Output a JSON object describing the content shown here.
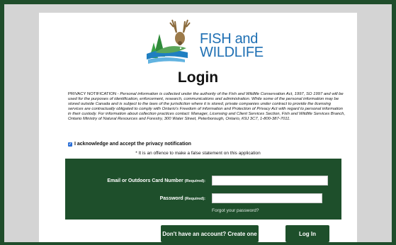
{
  "brand": {
    "line1": "FISH and",
    "line2": "WILDLIFE",
    "color": "#1e6fb3"
  },
  "page_title": "Login",
  "privacy": {
    "lead": "PRIVACY NOTIFICATION - ",
    "body": "Personal information is collected under the authority of the Fish and Wildlife Conservation Act, 1997, SO 1997 and will be used for the purposes of identification, enforcement, research, communications and administration. While some of the personal information may be stored outside Canada and is subject to the laws of the jurisdiction where it is stored, private companies under contract to provide the licensing services are contractually obligated to comply with Ontario's Freedom of information and Protection of Privacy Act with regard to personal information in their custody. For information about collection practices contact: Manager, Licensing and Client Services Section, Fish and Wildlife Services Branch, Ontario Ministry of Natural Resources and Forestry, 300 Water Street, Peterborough, Ontario, K9J 3C7, 1-800-387-7011."
  },
  "acknowledge_label": "I acknowledge and accept the privacy notification",
  "acknowledge_checked": true,
  "offence_note": "* It is an offence to make a false statement on this application",
  "form": {
    "email_label": "Email or Outdoors Card Number",
    "email_required": "(Required):",
    "email_value": "",
    "password_label": "Password",
    "password_required": "(Required):",
    "password_value": "",
    "forgot_link": "Forgot your password?"
  },
  "buttons": {
    "create_account": "Don't have an account? Create one",
    "login": "Log In"
  },
  "colors": {
    "primary_green": "#1e4f2b",
    "outer_border": "#1f4d2b",
    "background": "#d4d4d4",
    "check_blue": "#2b6fd6"
  }
}
